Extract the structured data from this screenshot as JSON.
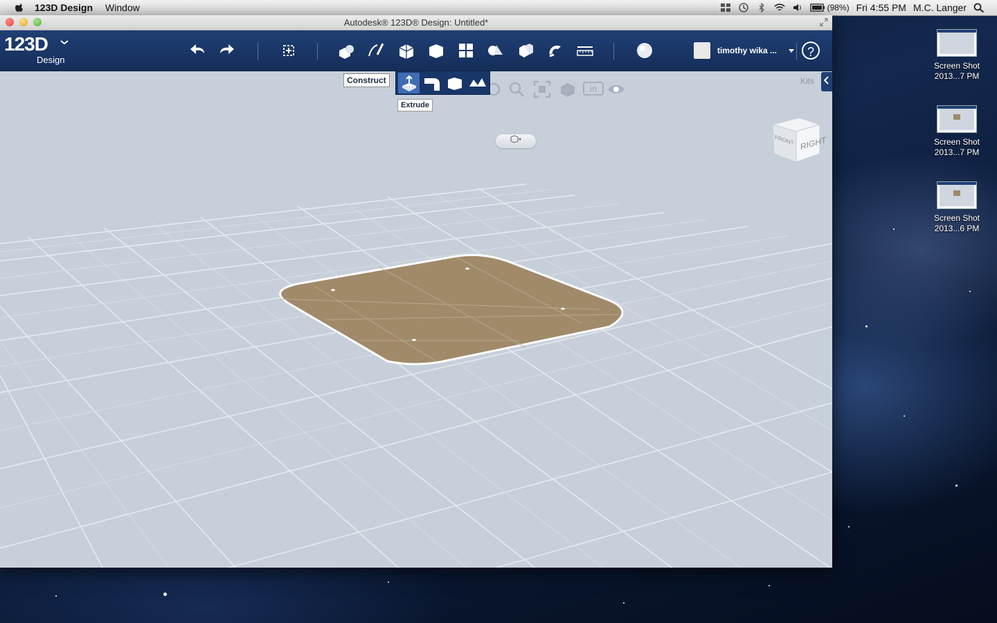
{
  "menubar": {
    "app_name": "123D Design",
    "menus": [
      "Window"
    ],
    "battery": "(98%)",
    "clock": "Fri 4:55 PM",
    "user": "M.C. Langer"
  },
  "window": {
    "title": "Autodesk® 123D® Design: Untitled*"
  },
  "toolbar": {
    "logo_main": "123D",
    "logo_sub": "Design",
    "tools": [
      "undo",
      "redo",
      "transform",
      "primitives",
      "sketch",
      "construct",
      "modify",
      "pattern",
      "grouping",
      "combine",
      "snap",
      "measure",
      "material"
    ],
    "username": "timothy wika ...",
    "help": "?"
  },
  "construct_menu": {
    "label": "Construct",
    "items": [
      "extrude",
      "sweep",
      "revolve",
      "loft"
    ],
    "tooltip": "Extrude"
  },
  "nav": {
    "units": "in",
    "kits_label": "Kits"
  },
  "viewcube": {
    "face_right": "RIGHT",
    "face_front": "FRONT"
  },
  "desktop_icons": [
    {
      "line1": "Screen Shot",
      "line2": "2013...7 PM"
    },
    {
      "line1": "Screen Shot",
      "line2": "2013...7 PM"
    },
    {
      "line1": "Screen Shot",
      "line2": "2013...6 PM"
    }
  ],
  "colors": {
    "toolbar": "#1f3f74",
    "viewport": "#c7d0da",
    "sketch_fill": "#a08a6a",
    "accent": "#3f6cb3"
  }
}
